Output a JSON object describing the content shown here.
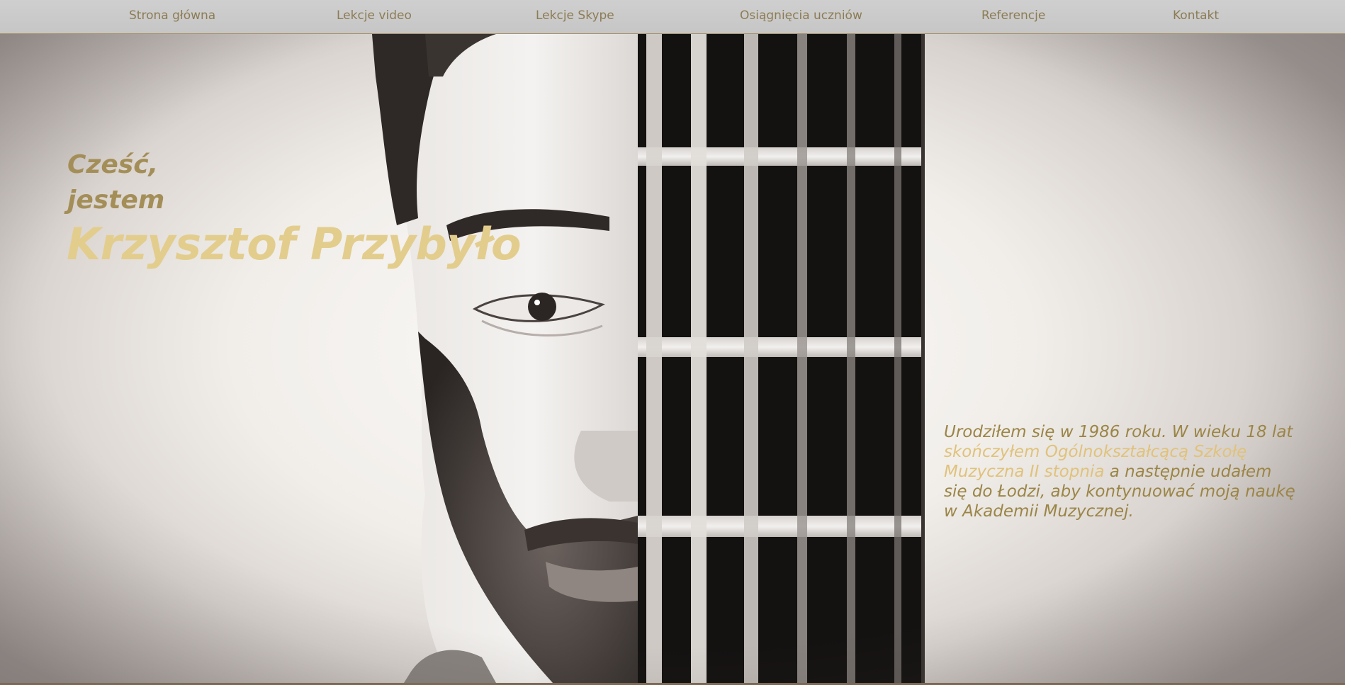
{
  "nav": {
    "items": [
      "Strona główna",
      "Lekcje video",
      "Lekcje Skype",
      "Osiągnięcia uczniów",
      "Referencje",
      "Kontakt"
    ]
  },
  "hero": {
    "greeting_line1": "Cześć,",
    "greeting_line2": "jestem",
    "name": "Krzysztof Przybyło",
    "bio": {
      "part1": "Urodziłem się w 1986 roku. W wieku 18 lat ",
      "highlight": "skończyłem Ogólnokształcącą Szkołę Muzyczna II stopnia",
      "part2": " a następnie udałem się do Łodzi, aby kontynuować moją naukę w Akademii Muzycznej."
    }
  },
  "colors": {
    "nav_bg": "#c9c9c9",
    "nav_text": "#8c7c55",
    "heading_gold": "#a48e58",
    "name_gold": "#e3cd8d",
    "bio_text": "#9b8546",
    "bio_highlight": "#e0c27b"
  }
}
